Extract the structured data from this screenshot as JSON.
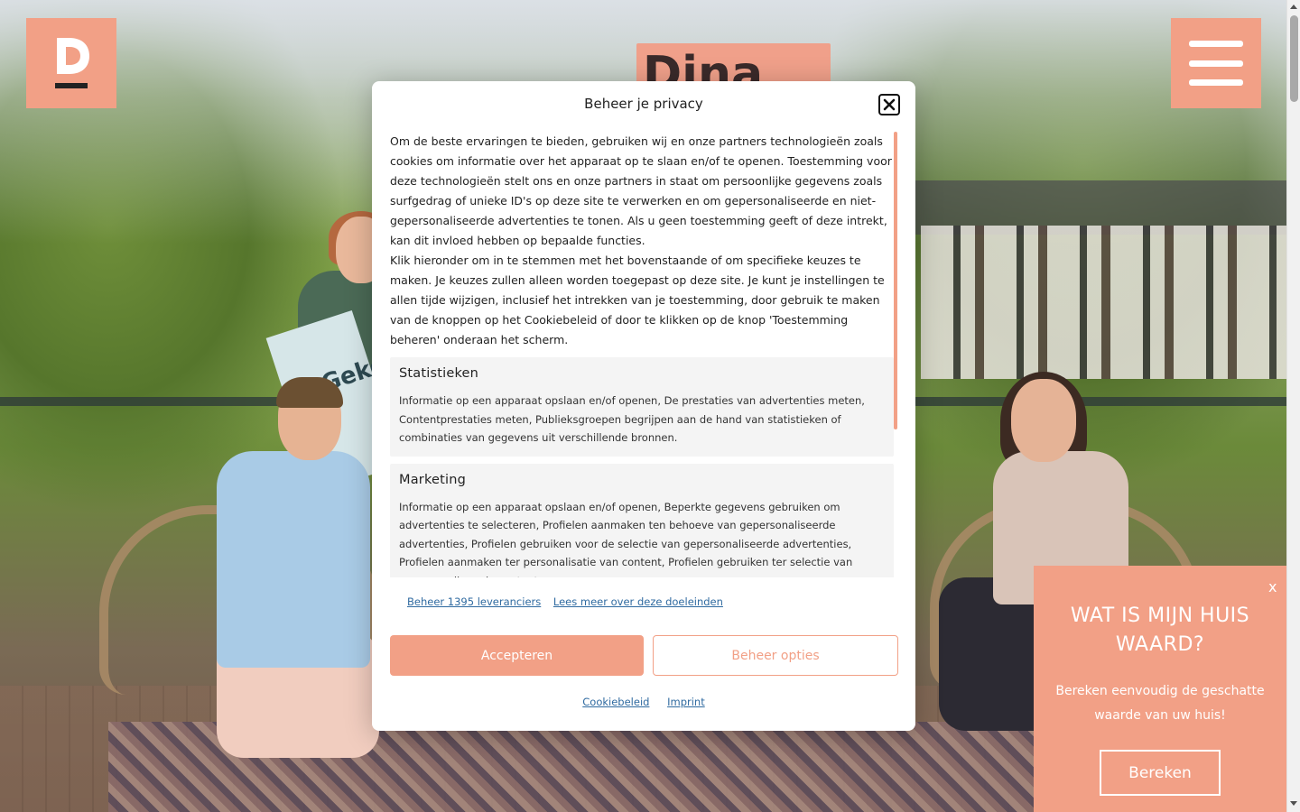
{
  "header": {
    "logo_icon": "brand-d-logo",
    "menu_icon": "hamburger-icon"
  },
  "hero": {
    "sign_text": "Dina",
    "placard_text": "Gekoc sam Th"
  },
  "privacy_modal": {
    "title": "Beheer je privacy",
    "close_icon": "close-icon",
    "intro_paragraph_1": "Om de beste ervaringen te bieden, gebruiken wij en onze partners technologieën zoals cookies om informatie over het apparaat op te slaan en/of te openen. Toestemming voor deze technologieën stelt ons en onze partners in staat om persoonlijke gegevens zoals surfgedrag of unieke ID's op deze site te verwerken en om gepersonaliseerde en niet-gepersonaliseerde advertenties te tonen. Als u geen toestemming geeft of deze intrekt, kan dit invloed hebben op bepaalde functies.",
    "intro_paragraph_2": "Klik hieronder om in te stemmen met het bovenstaande of om specifieke keuzes te maken. Je keuzes zullen alleen worden toegepast op deze site. Je kunt je instellingen te allen tijde wijzigen, inclusief het intrekken van je toestemming, door gebruik te maken van de knoppen op het Cookiebeleid of door te klikken op de knop 'Toestemming beheren' onderaan het scherm.",
    "categories": [
      {
        "title": "Statistieken",
        "description": "Informatie op een apparaat opslaan en/of openen, De prestaties van advertenties meten, Contentprestaties meten, Publieksgroepen begrijpen aan de hand van statistieken of combinaties van gegevens uit verschillende bronnen."
      },
      {
        "title": "Marketing",
        "description": "Informatie op een apparaat opslaan en/of openen, Beperkte gegevens gebruiken om advertenties te selecteren, Profielen aanmaken ten behoeve van gepersonaliseerde advertenties, Profielen gebruiken voor de selectie van gepersonaliseerde advertenties, Profielen aanmaken ter personalisatie van content, Profielen gebruiken ter selectie van gepersonaliseerde content,"
      }
    ],
    "link_vendors": "Beheer 1395 leveranciers",
    "link_purposes": "Lees meer over deze doeleinden",
    "accept_label": "Accepteren",
    "options_label": "Beheer opties",
    "footer_link_cookie": "Cookiebeleid",
    "footer_link_imprint": "Imprint"
  },
  "valuation_widget": {
    "close_label": "x",
    "title": "WAT IS MIJN HUIS WAARD?",
    "subtitle": "Bereken eenvoudig de geschatte waarde van uw huis!",
    "cta_label": "Bereken"
  },
  "colors": {
    "brand": "#f2a086",
    "link": "#2f6aa0"
  }
}
